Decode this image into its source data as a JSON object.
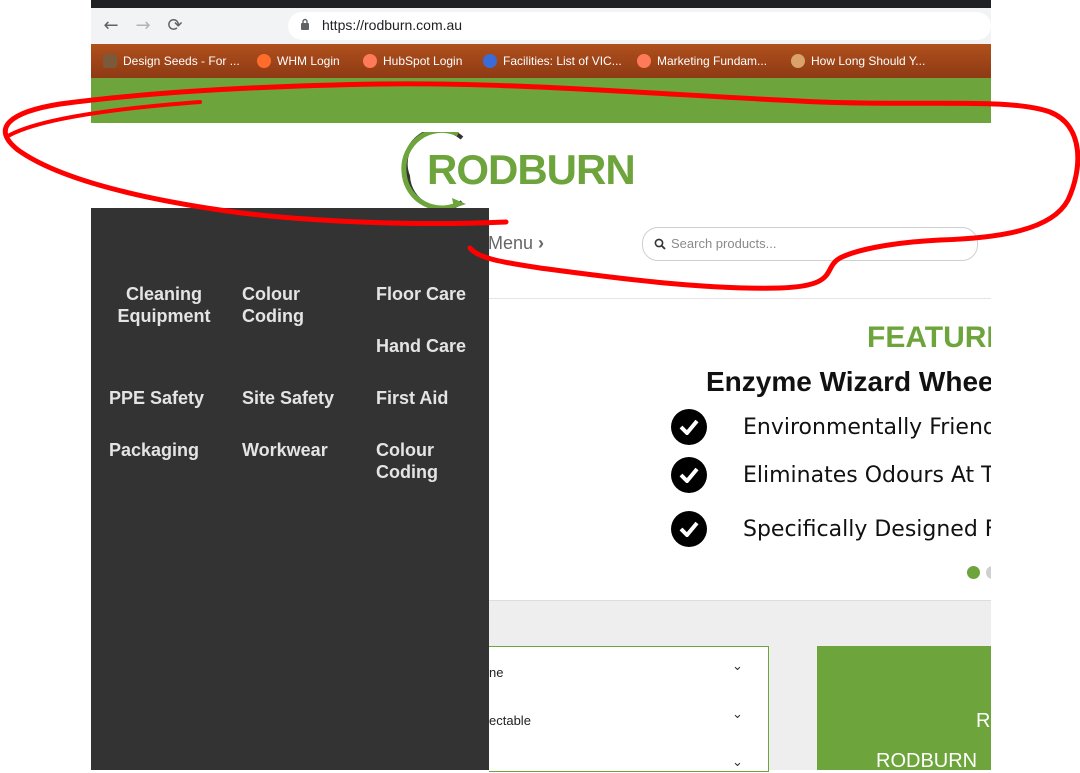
{
  "browser": {
    "url": "https://rodburn.com.au",
    "nav_back": "←",
    "nav_forward": "→",
    "nav_reload": "⟳",
    "bookmarks": [
      {
        "label": "Design Seeds - For ...",
        "icon": "design-seeds-icon",
        "color": "#7a5a3a"
      },
      {
        "label": "WHM Login",
        "icon": "cpanel-icon",
        "color": "#ff6c2c"
      },
      {
        "label": "HubSpot Login",
        "icon": "hubspot-icon",
        "color": "#ff7a59"
      },
      {
        "label": "Facilities: List of VIC...",
        "icon": "facilities-icon",
        "color": "#3b6bd6"
      },
      {
        "label": "Marketing Fundam...",
        "icon": "hubspot-icon",
        "color": "#ff7a59"
      },
      {
        "label": "How Long Should Y...",
        "icon": "avatar-icon",
        "color": "#d9a36b"
      }
    ]
  },
  "header": {
    "logo_text": "RODBURN",
    "menu_label": "Menu",
    "menu_chevron": "›",
    "search_placeholder": "Search products..."
  },
  "hero": {
    "heading": "FEATURED",
    "product": "Enzyme Wizard Wheelie",
    "features": [
      "Environmentally Friendl",
      "Eliminates Odours At Th",
      "Specifically Designed Fo"
    ],
    "active_slide_color": "#6da43b"
  },
  "sidebar_filter": {
    "rows": [
      {
        "label": "ne",
        "chevron": "⌄"
      },
      {
        "label": "ectable",
        "chevron": "⌄"
      },
      {
        "label": "",
        "chevron": "⌄"
      }
    ]
  },
  "promo": {
    "line1": "R",
    "line2": "RODBURN"
  },
  "mega_menu": {
    "items": [
      "Cleaning Equipment",
      "Colour Coding",
      "Floor Care",
      "Hand Care",
      "PPE Safety",
      "Site Safety",
      "First Aid",
      "Packaging",
      "Workwear",
      "Colour Coding"
    ]
  },
  "colors": {
    "brand_green": "#6da43b",
    "menu_bg": "#333333",
    "annotation_red": "#ff0000"
  }
}
